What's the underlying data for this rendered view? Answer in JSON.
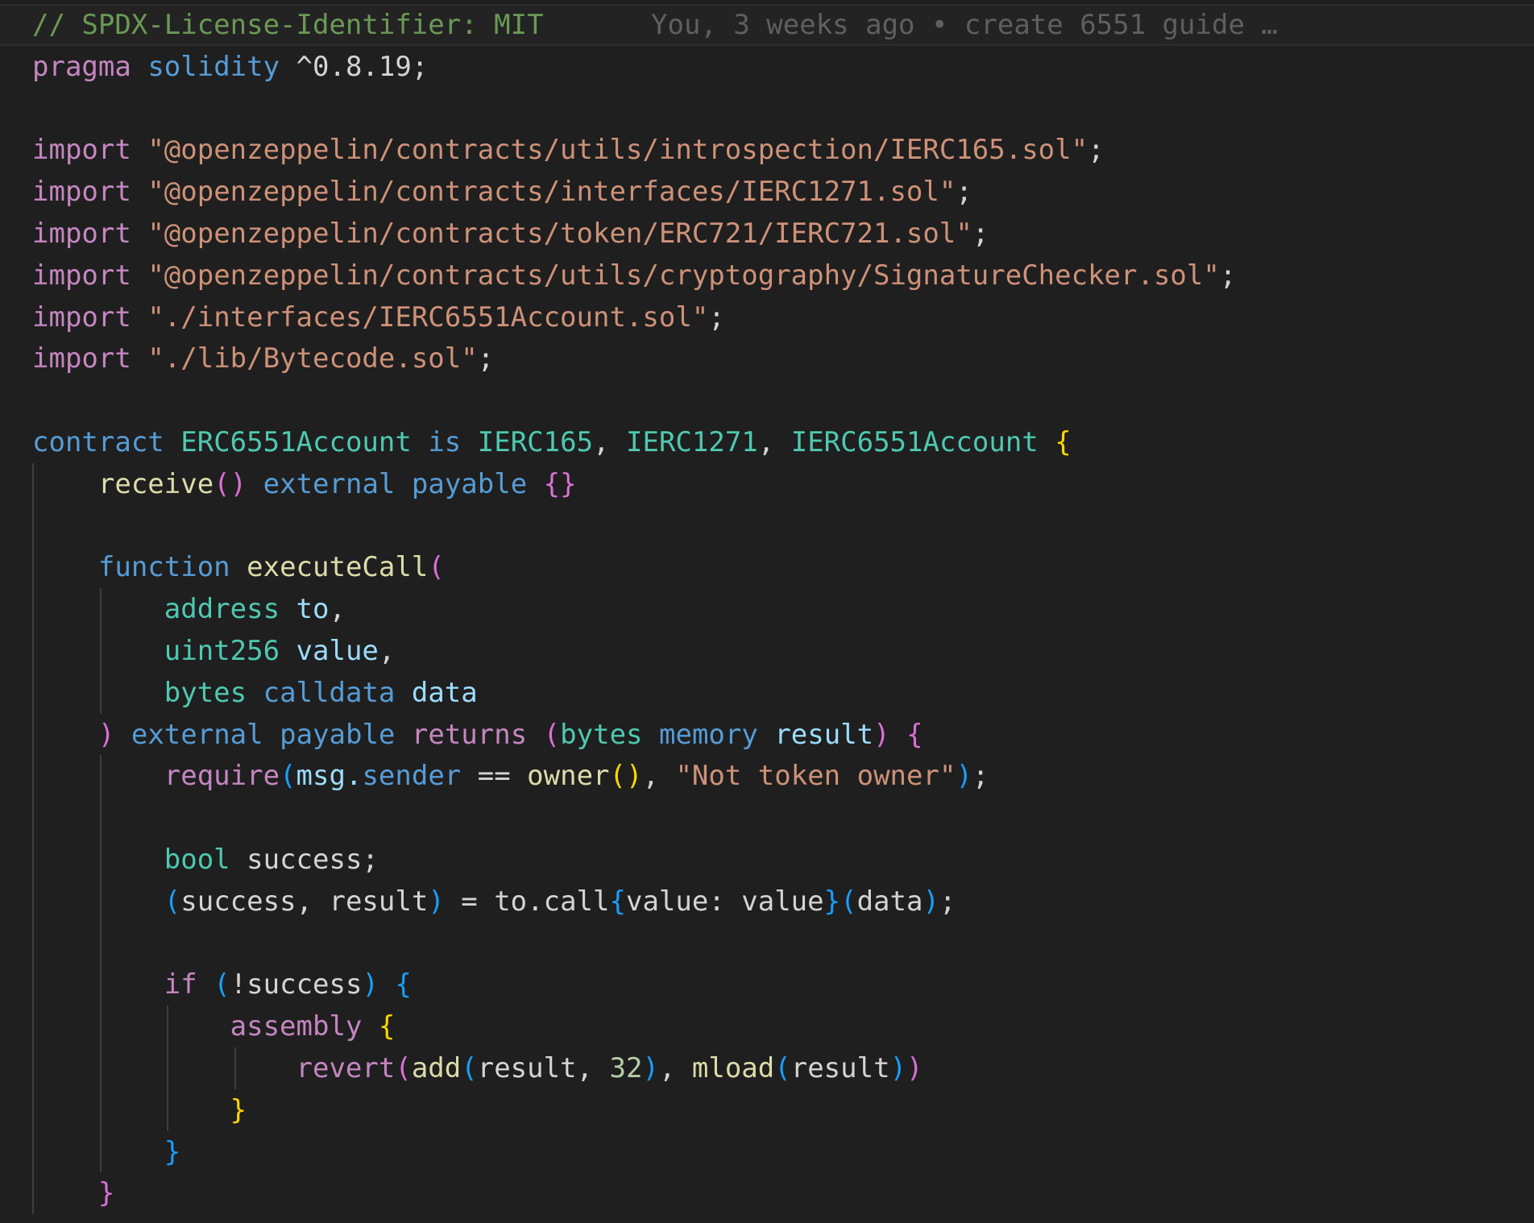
{
  "editor": {
    "colors": {
      "background": "#1f1f1f",
      "default": "#d4d4d4",
      "comment": "#6a9955",
      "keyword_purple": "#c586c0",
      "keyword_blue": "#569cd6",
      "type": "#4ec9b0",
      "function": "#dcdcaa",
      "string": "#ce9178",
      "variable": "#9cdcfe",
      "number": "#b5cea8",
      "bracket_gold": "#ffd700",
      "bracket_pink": "#da70d6",
      "bracket_blue": "#179fff",
      "blame": "#5f5f5f",
      "indent_guide": "#3e3e3e"
    },
    "blame": "You, 3 weeks ago • create 6551 guide …",
    "lines": [
      {
        "tokens": [
          {
            "text": "// SPDX-License-Identifier: MIT",
            "c": "comment"
          }
        ]
      },
      {
        "tokens": [
          {
            "text": "pragma",
            "c": "keyword_purple"
          },
          {
            "text": " "
          },
          {
            "text": "solidity",
            "c": "keyword_blue"
          },
          {
            "text": " ^0.8.19;"
          }
        ]
      },
      {
        "tokens": []
      },
      {
        "tokens": [
          {
            "text": "import",
            "c": "keyword_purple"
          },
          {
            "text": " "
          },
          {
            "text": "\"@openzeppelin/contracts/utils/introspection/IERC165.sol\"",
            "c": "string"
          },
          {
            "text": ";"
          }
        ]
      },
      {
        "tokens": [
          {
            "text": "import",
            "c": "keyword_purple"
          },
          {
            "text": " "
          },
          {
            "text": "\"@openzeppelin/contracts/interfaces/IERC1271.sol\"",
            "c": "string"
          },
          {
            "text": ";"
          }
        ]
      },
      {
        "tokens": [
          {
            "text": "import",
            "c": "keyword_purple"
          },
          {
            "text": " "
          },
          {
            "text": "\"@openzeppelin/contracts/token/ERC721/IERC721.sol\"",
            "c": "string"
          },
          {
            "text": ";"
          }
        ]
      },
      {
        "tokens": [
          {
            "text": "import",
            "c": "keyword_purple"
          },
          {
            "text": " "
          },
          {
            "text": "\"@openzeppelin/contracts/utils/cryptography/SignatureChecker.sol\"",
            "c": "string"
          },
          {
            "text": ";"
          }
        ]
      },
      {
        "tokens": [
          {
            "text": "import",
            "c": "keyword_purple"
          },
          {
            "text": " "
          },
          {
            "text": "\"./interfaces/IERC6551Account.sol\"",
            "c": "string"
          },
          {
            "text": ";"
          }
        ]
      },
      {
        "tokens": [
          {
            "text": "import",
            "c": "keyword_purple"
          },
          {
            "text": " "
          },
          {
            "text": "\"./lib/Bytecode.sol\"",
            "c": "string"
          },
          {
            "text": ";"
          }
        ]
      },
      {
        "tokens": []
      },
      {
        "tokens": [
          {
            "text": "contract",
            "c": "keyword_blue"
          },
          {
            "text": " "
          },
          {
            "text": "ERC6551Account",
            "c": "type"
          },
          {
            "text": " "
          },
          {
            "text": "is",
            "c": "keyword_blue"
          },
          {
            "text": " "
          },
          {
            "text": "IERC165",
            "c": "type"
          },
          {
            "text": ", "
          },
          {
            "text": "IERC1271",
            "c": "type"
          },
          {
            "text": ", "
          },
          {
            "text": "IERC6551Account",
            "c": "type"
          },
          {
            "text": " "
          },
          {
            "text": "{",
            "c": "bracket_gold"
          }
        ]
      },
      {
        "tokens": [
          {
            "text": "    "
          },
          {
            "text": "receive",
            "c": "function"
          },
          {
            "text": "()",
            "c": "bracket_pink"
          },
          {
            "text": " "
          },
          {
            "text": "external",
            "c": "keyword_blue"
          },
          {
            "text": " "
          },
          {
            "text": "payable",
            "c": "keyword_blue"
          },
          {
            "text": " "
          },
          {
            "text": "{}",
            "c": "bracket_pink"
          }
        ]
      },
      {
        "tokens": []
      },
      {
        "tokens": [
          {
            "text": "    "
          },
          {
            "text": "function",
            "c": "keyword_blue"
          },
          {
            "text": " "
          },
          {
            "text": "executeCall",
            "c": "function"
          },
          {
            "text": "(",
            "c": "bracket_pink"
          }
        ]
      },
      {
        "tokens": [
          {
            "text": "        "
          },
          {
            "text": "address",
            "c": "type"
          },
          {
            "text": " "
          },
          {
            "text": "to",
            "c": "variable"
          },
          {
            "text": ","
          }
        ]
      },
      {
        "tokens": [
          {
            "text": "        "
          },
          {
            "text": "uint256",
            "c": "type"
          },
          {
            "text": " "
          },
          {
            "text": "value",
            "c": "variable"
          },
          {
            "text": ","
          }
        ]
      },
      {
        "tokens": [
          {
            "text": "        "
          },
          {
            "text": "bytes",
            "c": "type"
          },
          {
            "text": " "
          },
          {
            "text": "calldata",
            "c": "keyword_blue"
          },
          {
            "text": " "
          },
          {
            "text": "data",
            "c": "variable"
          }
        ]
      },
      {
        "tokens": [
          {
            "text": "    "
          },
          {
            "text": ")",
            "c": "bracket_pink"
          },
          {
            "text": " "
          },
          {
            "text": "external",
            "c": "keyword_blue"
          },
          {
            "text": " "
          },
          {
            "text": "payable",
            "c": "keyword_blue"
          },
          {
            "text": " "
          },
          {
            "text": "returns",
            "c": "keyword_purple"
          },
          {
            "text": " "
          },
          {
            "text": "(",
            "c": "bracket_pink"
          },
          {
            "text": "bytes",
            "c": "type"
          },
          {
            "text": " "
          },
          {
            "text": "memory",
            "c": "keyword_blue"
          },
          {
            "text": " "
          },
          {
            "text": "result",
            "c": "variable"
          },
          {
            "text": ")",
            "c": "bracket_pink"
          },
          {
            "text": " "
          },
          {
            "text": "{",
            "c": "bracket_pink"
          }
        ]
      },
      {
        "tokens": [
          {
            "text": "        "
          },
          {
            "text": "require",
            "c": "keyword_purple"
          },
          {
            "text": "(",
            "c": "bracket_blue"
          },
          {
            "text": "msg",
            "c": "variable"
          },
          {
            "text": ".",
            "c": "variable"
          },
          {
            "text": "sender",
            "c": "keyword_blue"
          },
          {
            "text": " == "
          },
          {
            "text": "owner",
            "c": "function"
          },
          {
            "text": "()",
            "c": "bracket_gold"
          },
          {
            "text": ", "
          },
          {
            "text": "\"Not token owner\"",
            "c": "string"
          },
          {
            "text": ")",
            "c": "bracket_blue"
          },
          {
            "text": ";"
          }
        ]
      },
      {
        "tokens": []
      },
      {
        "tokens": [
          {
            "text": "        "
          },
          {
            "text": "bool",
            "c": "type"
          },
          {
            "text": " success;"
          }
        ]
      },
      {
        "tokens": [
          {
            "text": "        "
          },
          {
            "text": "(",
            "c": "bracket_blue"
          },
          {
            "text": "success, result"
          },
          {
            "text": ")",
            "c": "bracket_blue"
          },
          {
            "text": " = to.call"
          },
          {
            "text": "{",
            "c": "bracket_blue"
          },
          {
            "text": "value: value"
          },
          {
            "text": "}",
            "c": "bracket_blue"
          },
          {
            "text": "(",
            "c": "bracket_blue"
          },
          {
            "text": "data"
          },
          {
            "text": ")",
            "c": "bracket_blue"
          },
          {
            "text": ";"
          }
        ]
      },
      {
        "tokens": []
      },
      {
        "tokens": [
          {
            "text": "        "
          },
          {
            "text": "if",
            "c": "keyword_purple"
          },
          {
            "text": " "
          },
          {
            "text": "(",
            "c": "bracket_blue"
          },
          {
            "text": "!success"
          },
          {
            "text": ")",
            "c": "bracket_blue"
          },
          {
            "text": " "
          },
          {
            "text": "{",
            "c": "bracket_blue"
          }
        ]
      },
      {
        "tokens": [
          {
            "text": "            "
          },
          {
            "text": "assembly",
            "c": "keyword_purple"
          },
          {
            "text": " "
          },
          {
            "text": "{",
            "c": "bracket_gold"
          }
        ]
      },
      {
        "tokens": [
          {
            "text": "                "
          },
          {
            "text": "revert",
            "c": "keyword_purple"
          },
          {
            "text": "(",
            "c": "bracket_pink"
          },
          {
            "text": "add",
            "c": "function"
          },
          {
            "text": "(",
            "c": "bracket_blue"
          },
          {
            "text": "result, "
          },
          {
            "text": "32",
            "c": "number"
          },
          {
            "text": ")",
            "c": "bracket_blue"
          },
          {
            "text": ", "
          },
          {
            "text": "mload",
            "c": "function"
          },
          {
            "text": "(",
            "c": "bracket_blue"
          },
          {
            "text": "result"
          },
          {
            "text": ")",
            "c": "bracket_blue"
          },
          {
            "text": ")",
            "c": "bracket_pink"
          }
        ]
      },
      {
        "tokens": [
          {
            "text": "            "
          },
          {
            "text": "}",
            "c": "bracket_gold"
          }
        ]
      },
      {
        "tokens": [
          {
            "text": "        "
          },
          {
            "text": "}",
            "c": "bracket_blue"
          }
        ]
      },
      {
        "tokens": [
          {
            "text": "    "
          },
          {
            "text": "}",
            "c": "bracket_pink"
          }
        ]
      }
    ]
  }
}
